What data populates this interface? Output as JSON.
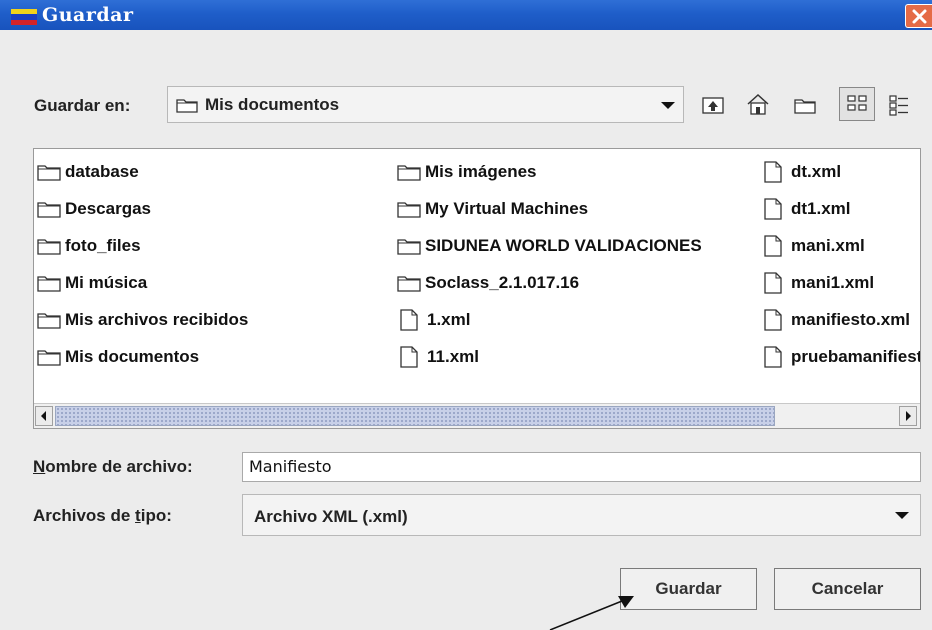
{
  "dialog": {
    "title": "Guardar"
  },
  "toolbar": {
    "look_in_label": "Guardar en:",
    "look_in_value": "Mis documentos",
    "icons": [
      "up-folder-icon",
      "home-icon",
      "new-folder-icon",
      "list-view-icon",
      "details-view-icon"
    ]
  },
  "files": {
    "column1": [
      {
        "name": "database",
        "type": "folder"
      },
      {
        "name": "Descargas",
        "type": "folder"
      },
      {
        "name": "foto_files",
        "type": "folder"
      },
      {
        "name": "Mi música",
        "type": "folder"
      },
      {
        "name": "Mis archivos recibidos",
        "type": "folder"
      },
      {
        "name": "Mis documentos",
        "type": "folder"
      }
    ],
    "column2": [
      {
        "name": "Mis imágenes",
        "type": "folder"
      },
      {
        "name": "My Virtual Machines",
        "type": "folder"
      },
      {
        "name": "SIDUNEA WORLD VALIDACIONES",
        "type": "folder"
      },
      {
        "name": "Soclass_2.1.017.16",
        "type": "folder"
      },
      {
        "name": "1.xml",
        "type": "file"
      },
      {
        "name": "11.xml",
        "type": "file"
      }
    ],
    "column3": [
      {
        "name": "dt.xml",
        "type": "file"
      },
      {
        "name": "dt1.xml",
        "type": "file"
      },
      {
        "name": "mani.xml",
        "type": "file"
      },
      {
        "name": "mani1.xml",
        "type": "file"
      },
      {
        "name": "manifiesto.xml",
        "type": "file"
      },
      {
        "name": "pruebamanifiesto.xml",
        "type": "file"
      }
    ]
  },
  "filename": {
    "label_mnemonic": "N",
    "label_rest": "ombre de archivo:",
    "value": "Manifiesto"
  },
  "filetype": {
    "label_pre": "Archivos de ",
    "label_mnemonic": "t",
    "label_post": "ipo:",
    "value": "Archivo XML (.xml)"
  },
  "buttons": {
    "save": "Guardar",
    "cancel": "Cancelar"
  },
  "colors": {
    "titlebar": "#1f5ec9",
    "close": "#e56b46",
    "scroll_thumb": "#c8d0e8"
  }
}
